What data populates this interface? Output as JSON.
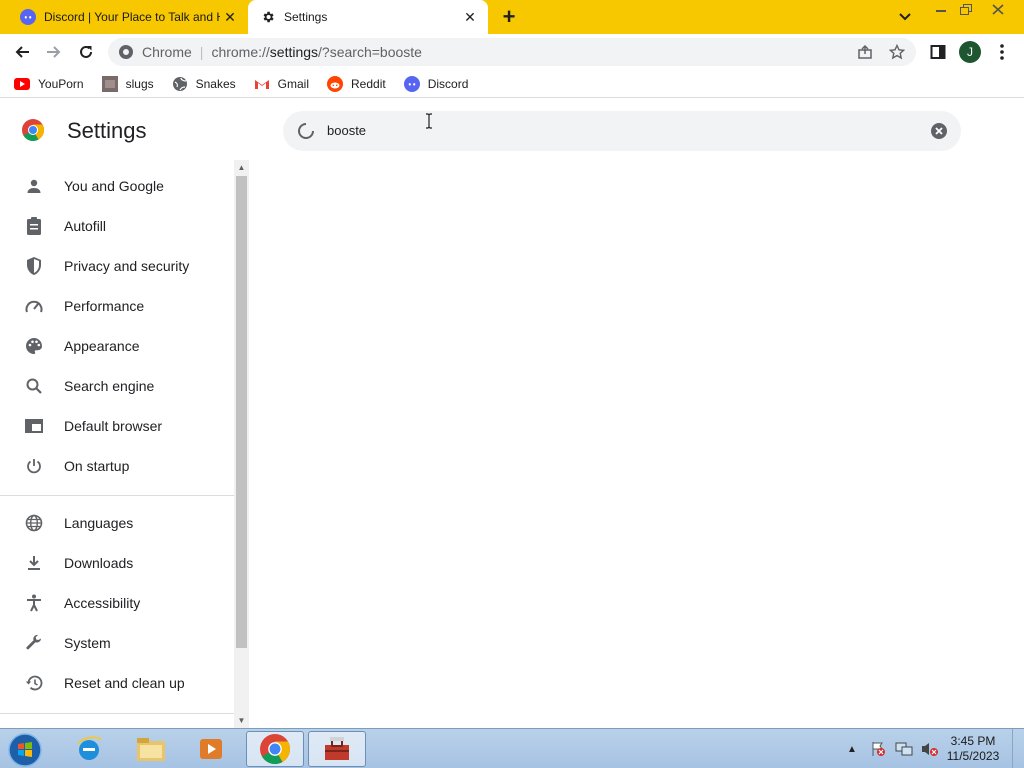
{
  "browser": {
    "tabs": [
      {
        "title": "Discord | Your Place to Talk and H",
        "favicon": "discord-icon",
        "active": false
      },
      {
        "title": "Settings",
        "favicon": "gear-icon",
        "active": true
      }
    ],
    "omnibox": {
      "label": "Chrome",
      "url_prefix": "chrome://",
      "url_host": "settings",
      "url_rest": "/?search=booste"
    },
    "profile_initial": "J",
    "bookmarks": [
      {
        "label": "YouPorn",
        "icon": "youtube-red-icon"
      },
      {
        "label": "slugs",
        "icon": "image-thumbnail-icon"
      },
      {
        "label": "Snakes",
        "icon": "globe-icon"
      },
      {
        "label": "Gmail",
        "icon": "gmail-icon"
      },
      {
        "label": "Reddit",
        "icon": "reddit-icon"
      },
      {
        "label": "Discord",
        "icon": "discord-icon"
      }
    ]
  },
  "settings": {
    "title": "Settings",
    "search_value": "booste",
    "nav_items": [
      {
        "label": "You and Google",
        "icon": "person-icon"
      },
      {
        "label": "Autofill",
        "icon": "clipboard-icon"
      },
      {
        "label": "Privacy and security",
        "icon": "shield-icon"
      },
      {
        "label": "Performance",
        "icon": "speedometer-icon"
      },
      {
        "label": "Appearance",
        "icon": "palette-icon"
      },
      {
        "label": "Search engine",
        "icon": "search-icon"
      },
      {
        "label": "Default browser",
        "icon": "browser-window-icon"
      },
      {
        "label": "On startup",
        "icon": "power-icon"
      },
      {
        "label": "Languages",
        "icon": "globe-icon"
      },
      {
        "label": "Downloads",
        "icon": "download-icon"
      },
      {
        "label": "Accessibility",
        "icon": "accessibility-icon"
      },
      {
        "label": "System",
        "icon": "wrench-icon"
      },
      {
        "label": "Reset and clean up",
        "icon": "history-icon"
      }
    ]
  },
  "taskbar": {
    "clock_time": "3:45 PM",
    "clock_date": "11/5/2023"
  },
  "colors": {
    "tabstrip": "#f7c700",
    "accent": "#1a73e8"
  }
}
